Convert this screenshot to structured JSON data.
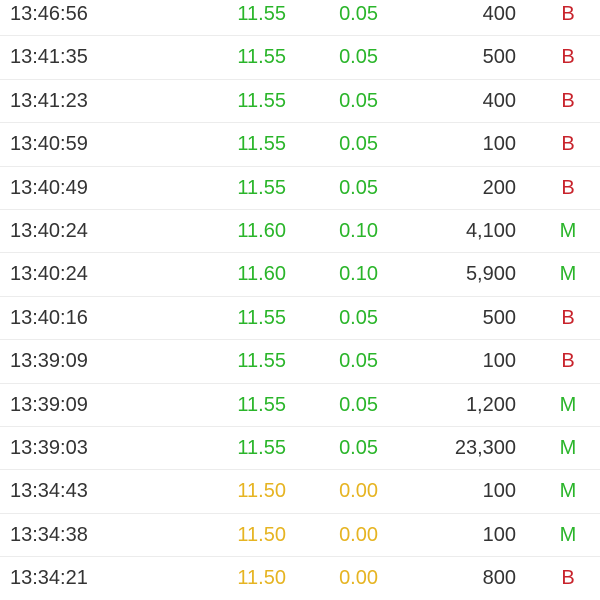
{
  "colors": {
    "up": "#2ab52a",
    "flat": "#e6b422",
    "buy_side": "#c8232c",
    "other_side": "#2ab52a",
    "text": "#333333"
  },
  "trades": [
    {
      "time": "13:46:56",
      "price": "11.55",
      "change": "0.05",
      "volume": "400",
      "side": "B",
      "trend": "up"
    },
    {
      "time": "13:41:35",
      "price": "11.55",
      "change": "0.05",
      "volume": "500",
      "side": "B",
      "trend": "up"
    },
    {
      "time": "13:41:23",
      "price": "11.55",
      "change": "0.05",
      "volume": "400",
      "side": "B",
      "trend": "up"
    },
    {
      "time": "13:40:59",
      "price": "11.55",
      "change": "0.05",
      "volume": "100",
      "side": "B",
      "trend": "up"
    },
    {
      "time": "13:40:49",
      "price": "11.55",
      "change": "0.05",
      "volume": "200",
      "side": "B",
      "trend": "up"
    },
    {
      "time": "13:40:24",
      "price": "11.60",
      "change": "0.10",
      "volume": "4,100",
      "side": "M",
      "trend": "up"
    },
    {
      "time": "13:40:24",
      "price": "11.60",
      "change": "0.10",
      "volume": "5,900",
      "side": "M",
      "trend": "up"
    },
    {
      "time": "13:40:16",
      "price": "11.55",
      "change": "0.05",
      "volume": "500",
      "side": "B",
      "trend": "up"
    },
    {
      "time": "13:39:09",
      "price": "11.55",
      "change": "0.05",
      "volume": "100",
      "side": "B",
      "trend": "up"
    },
    {
      "time": "13:39:09",
      "price": "11.55",
      "change": "0.05",
      "volume": "1,200",
      "side": "M",
      "trend": "up"
    },
    {
      "time": "13:39:03",
      "price": "11.55",
      "change": "0.05",
      "volume": "23,300",
      "side": "M",
      "trend": "up"
    },
    {
      "time": "13:34:43",
      "price": "11.50",
      "change": "0.00",
      "volume": "100",
      "side": "M",
      "trend": "flat"
    },
    {
      "time": "13:34:38",
      "price": "11.50",
      "change": "0.00",
      "volume": "100",
      "side": "M",
      "trend": "flat"
    },
    {
      "time": "13:34:21",
      "price": "11.50",
      "change": "0.00",
      "volume": "800",
      "side": "B",
      "trend": "flat"
    }
  ]
}
